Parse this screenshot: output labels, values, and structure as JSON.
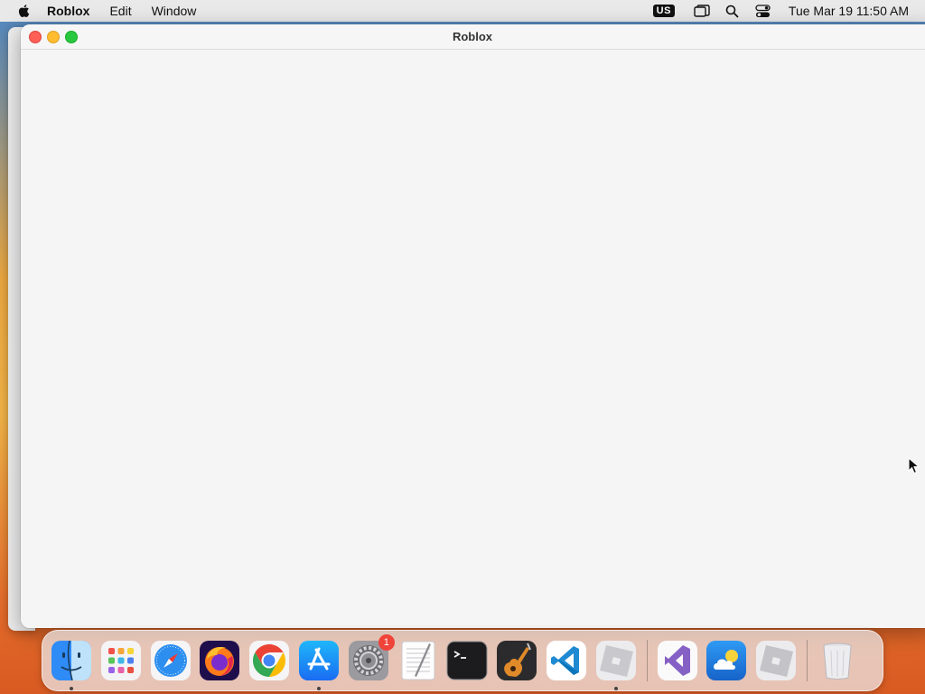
{
  "menubar": {
    "app_name": "Roblox",
    "items": [
      "Edit",
      "Window"
    ],
    "input_source": "US",
    "clock": "Tue Mar 19  11:50 AM"
  },
  "window": {
    "title": "Roblox"
  },
  "dock": {
    "items": [
      {
        "name": "Finder",
        "icon": "finder-icon",
        "running": true
      },
      {
        "name": "Launchpad",
        "icon": "launchpad-icon",
        "running": false
      },
      {
        "name": "Safari",
        "icon": "safari-icon",
        "running": false
      },
      {
        "name": "Firefox",
        "icon": "firefox-icon",
        "running": false
      },
      {
        "name": "Google Chrome",
        "icon": "chrome-icon",
        "running": false
      },
      {
        "name": "App Store",
        "icon": "app-store-icon",
        "running": true
      },
      {
        "name": "System Settings",
        "icon": "system-settings-icon",
        "running": false,
        "badge": "1"
      },
      {
        "name": "TextEdit",
        "icon": "textedit-icon",
        "running": false
      },
      {
        "name": "Terminal",
        "icon": "terminal-icon",
        "running": false
      },
      {
        "name": "GarageBand",
        "icon": "garageband-icon",
        "running": false
      },
      {
        "name": "Visual Studio Code",
        "icon": "vscode-icon",
        "running": false
      },
      {
        "name": "Roblox",
        "icon": "roblox-icon",
        "running": true
      },
      {
        "name": "Visual Studio",
        "icon": "visual-studio-icon",
        "running": false
      },
      {
        "name": "Weather",
        "icon": "weather-icon",
        "running": false
      },
      {
        "name": "Roblox Studio",
        "icon": "roblox-studio-icon",
        "running": false
      },
      {
        "name": "Trash",
        "icon": "trash-icon",
        "running": false
      }
    ]
  },
  "colors": {
    "close": "#fe5f57",
    "minimize": "#febc2e",
    "zoom": "#28c840",
    "badge": "#f0443a"
  }
}
